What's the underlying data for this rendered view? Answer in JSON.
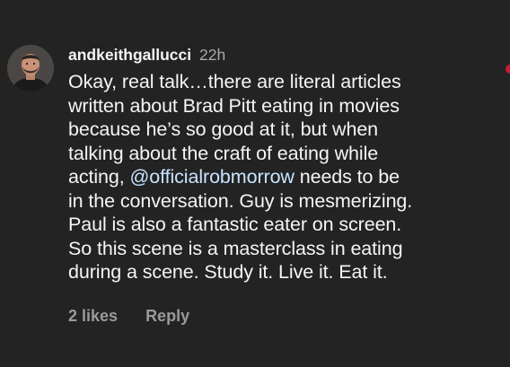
{
  "comment": {
    "username": "andkeithgallucci",
    "time": "22h",
    "lines": [
      {
        "text": "Okay, real talk…there are literal articles"
      },
      {
        "text": "written about Brad Pitt eating in movies"
      },
      {
        "text": "because he’s so good at it, but when"
      },
      {
        "text": "talking about the craft of eating while"
      },
      {
        "pre": "acting, ",
        "mention": "@officialrobmorrow",
        "post": " needs to be"
      },
      {
        "text": "in the conversation. Guy is mesmerizing."
      },
      {
        "text": "Paul is also a fantastic eater on screen."
      },
      {
        "text": "So this scene is a masterclass in eating"
      },
      {
        "text": "during a scene. Study it. Live it. Eat it."
      }
    ],
    "likes_label": "2 likes",
    "reply_label": "Reply"
  },
  "colors": {
    "background": "#232323",
    "text": "#f5f5f5",
    "muted": "#a8a8a8",
    "mention": "#c7e3ff",
    "accent_dot": "#c41e35"
  },
  "icons": {
    "avatar": "user-avatar-photo"
  }
}
